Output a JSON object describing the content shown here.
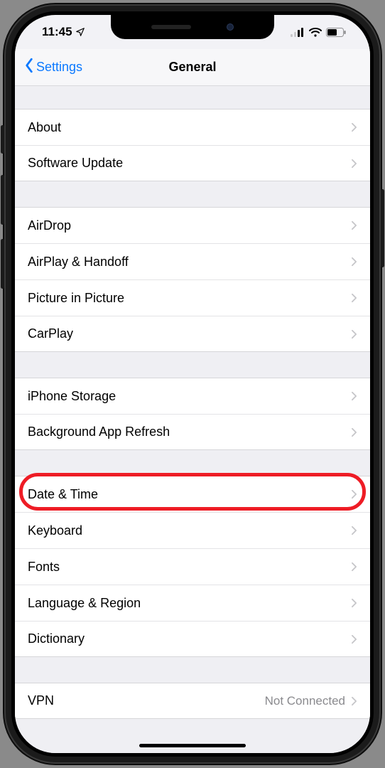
{
  "status": {
    "time": "11:45",
    "location_icon": "location-arrow"
  },
  "nav": {
    "back_label": "Settings",
    "title": "General"
  },
  "groups": [
    {
      "items": [
        {
          "key": "about",
          "label": "About"
        },
        {
          "key": "software-update",
          "label": "Software Update"
        }
      ]
    },
    {
      "items": [
        {
          "key": "airdrop",
          "label": "AirDrop"
        },
        {
          "key": "airplay",
          "label": "AirPlay & Handoff"
        },
        {
          "key": "pip",
          "label": "Picture in Picture"
        },
        {
          "key": "carplay",
          "label": "CarPlay"
        }
      ]
    },
    {
      "items": [
        {
          "key": "iphone-storage",
          "label": "iPhone Storage"
        },
        {
          "key": "bg-refresh",
          "label": "Background App Refresh"
        }
      ]
    },
    {
      "items": [
        {
          "key": "date-time",
          "label": "Date & Time",
          "highlighted": true
        },
        {
          "key": "keyboard",
          "label": "Keyboard"
        },
        {
          "key": "fonts",
          "label": "Fonts"
        },
        {
          "key": "lang-region",
          "label": "Language & Region"
        },
        {
          "key": "dictionary",
          "label": "Dictionary"
        }
      ]
    },
    {
      "items": [
        {
          "key": "vpn",
          "label": "VPN",
          "detail": "Not Connected"
        }
      ]
    }
  ]
}
